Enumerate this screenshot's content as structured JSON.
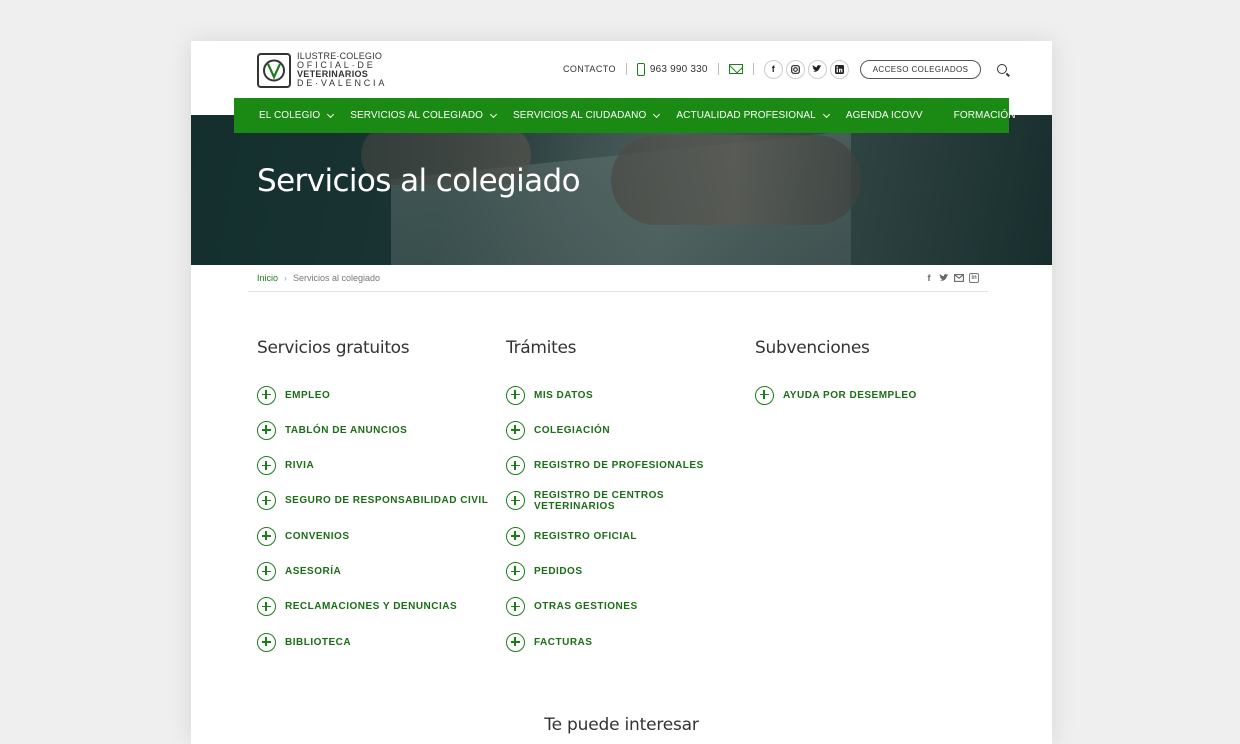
{
  "header": {
    "logo": {
      "line1": "ILUSTRE·COLEGIO",
      "line2": "OFICIAL·DE",
      "line3": "VETERINARIOS",
      "line4": "DE·VALENCIA"
    },
    "contact_label": "CONTACTO",
    "phone": "963 990 330",
    "socials": [
      "facebook-icon",
      "instagram-icon",
      "twitter-icon",
      "linkedin-icon"
    ],
    "acceso_label": "ACCESO COLEGIADOS"
  },
  "nav": {
    "items": [
      {
        "label": "EL COLEGIO",
        "has_dropdown": true
      },
      {
        "label": "SERVICIOS AL COLEGIADO",
        "has_dropdown": true
      },
      {
        "label": "SERVICIOS AL CIUDADANO",
        "has_dropdown": true
      },
      {
        "label": "ACTUALIDAD PROFESIONAL",
        "has_dropdown": true
      },
      {
        "label": "AGENDA ICOVV",
        "has_dropdown": false
      },
      {
        "label": "FORMACIÓN",
        "has_dropdown": false
      }
    ]
  },
  "hero": {
    "title": "Servicios al colegiado"
  },
  "breadcrumb": {
    "home": "Inicio",
    "current": "Servicios al colegiado"
  },
  "columns": [
    {
      "title": "Servicios gratuitos",
      "items": [
        "EMPLEO",
        "TABLÓN DE ANUNCIOS",
        "RIVIA",
        "SEGURO DE RESPONSABILIDAD CIVIL",
        "CONVENIOS",
        "ASESORÍA",
        "RECLAMACIONES Y DENUNCIAS",
        "BIBLIOTECA"
      ]
    },
    {
      "title": "Trámites",
      "items": [
        "MIS DATOS",
        "COLEGIACIÓN",
        "REGISTRO DE PROFESIONALES",
        "REGISTRO DE CENTROS VETERINARIOS",
        "REGISTRO OFICIAL",
        "PEDIDOS",
        "OTRAS GESTIONES",
        "FACTURAS"
      ]
    },
    {
      "title": "Subvenciones",
      "items": [
        "AYUDA POR DESEMPLEO"
      ]
    }
  ],
  "footer_heading": "Te puede interesar",
  "colors": {
    "brand_green": "#1b8a14",
    "link_green": "#1b6d16",
    "text": "#333333"
  }
}
